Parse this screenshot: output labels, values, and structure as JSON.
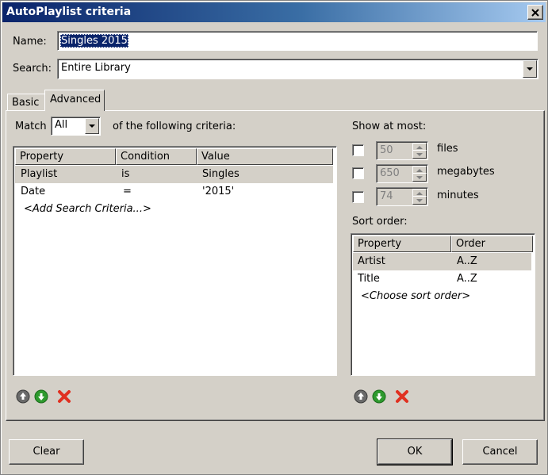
{
  "window": {
    "title": "AutoPlaylist criteria"
  },
  "name": {
    "label": "Name:",
    "value": "Singles 2015"
  },
  "search": {
    "label": "Search:",
    "value": "Entire Library"
  },
  "tabs": [
    {
      "label": "Basic"
    },
    {
      "label": "Advanced"
    }
  ],
  "criteria": {
    "match_label": "Match",
    "match_value": "All",
    "following_label": "of the following criteria:",
    "columns": [
      "Property",
      "Condition",
      "Value"
    ],
    "rows": [
      {
        "property": "Playlist",
        "condition": "is",
        "value": "Singles"
      },
      {
        "property": "Date",
        "condition": "=",
        "value": "'2015'"
      }
    ],
    "add_link": "<Add Search Criteria...>"
  },
  "limits": {
    "label": "Show at most:",
    "items": [
      {
        "value": "50",
        "unit": "files",
        "checked": false
      },
      {
        "value": "650",
        "unit": "megabytes",
        "checked": false
      },
      {
        "value": "74",
        "unit": "minutes",
        "checked": false
      }
    ]
  },
  "sort": {
    "label": "Sort order:",
    "columns": [
      "Property",
      "Order"
    ],
    "rows": [
      {
        "property": "Artist",
        "order": "A..Z"
      },
      {
        "property": "Title",
        "order": "A..Z"
      }
    ],
    "add_link": "<Choose sort order>"
  },
  "buttons": {
    "clear": "Clear",
    "ok": "OK",
    "cancel": "Cancel"
  },
  "icons": {
    "move_up": "arrow-up-circle-icon",
    "move_down": "arrow-down-circle-icon",
    "remove": "red-x-icon"
  },
  "colors": {
    "title_bar_start": "#0a246a",
    "title_bar_end": "#a6caf0",
    "selection": "#0a246a",
    "move_down_green": "#2e9a2e",
    "remove_red": "#e03020"
  }
}
